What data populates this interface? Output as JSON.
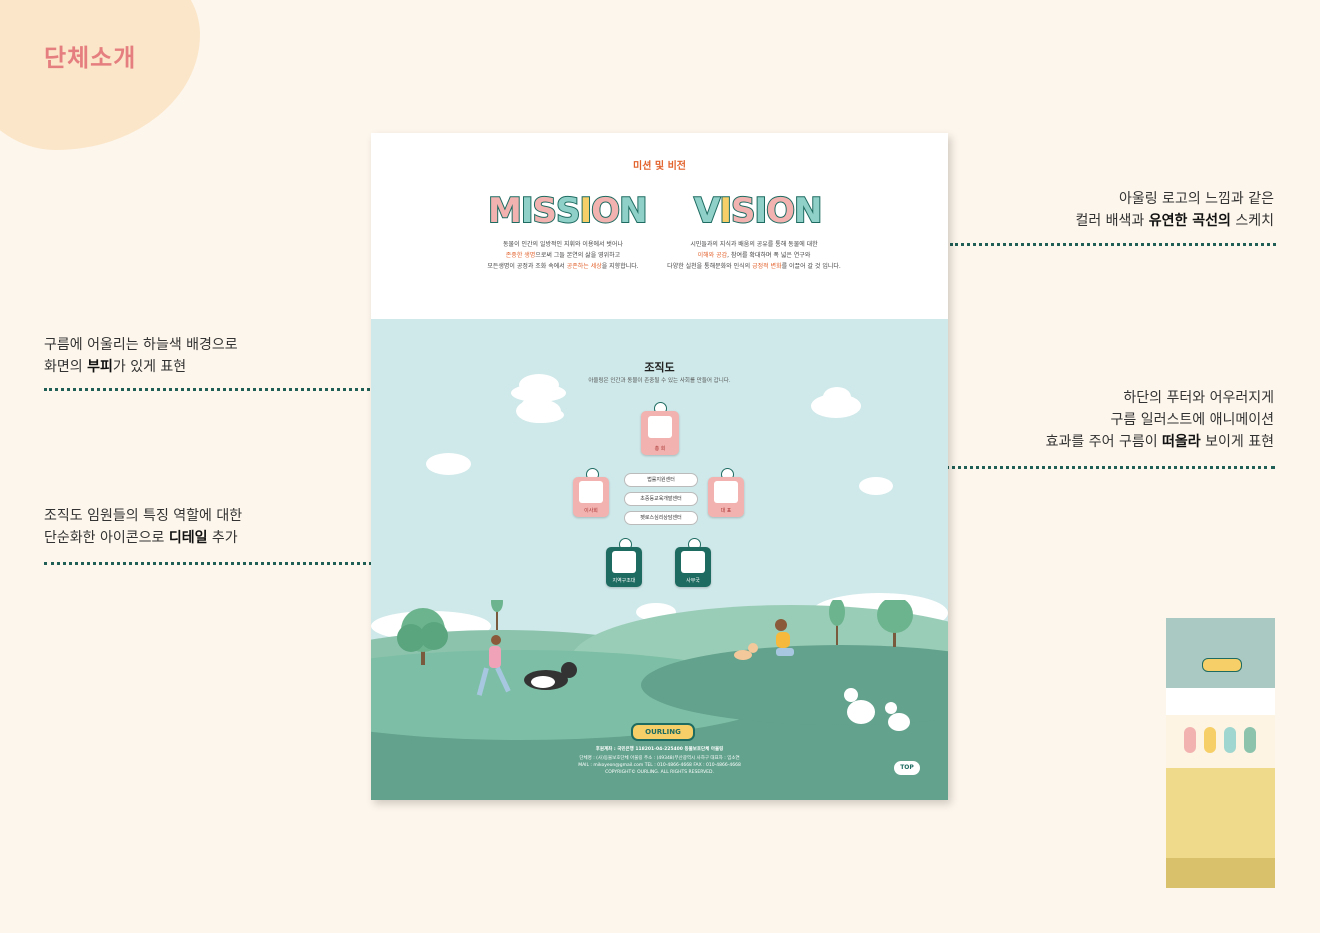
{
  "page": {
    "title": "단체소개"
  },
  "notes": {
    "right_top": {
      "line1": "아울링 로고의 느낌과 같은",
      "line2_pre": "컬러 배색과 ",
      "line2_bold": "유연한 곡선의",
      "line2_post": " 스케치"
    },
    "left_top": {
      "line1": "구름에 어울리는 하늘색 배경으로",
      "line2_pre": "화면의 ",
      "line2_bold": "부피",
      "line2_post": "가 있게 표현"
    },
    "right_mid": {
      "line1": "하단의 푸터와 어우러지게",
      "line2": "구름  일러스트에 애니메이션",
      "line3_pre": "효과를 주어 구름이 ",
      "line3_bold": "떠올라",
      "line3_post": " 보이게 표현"
    },
    "left_bottom": {
      "line1": "조직도 임원들의 특징 역할에 대한",
      "line2_pre": "단순화한 아이콘으로 ",
      "line2_bold": "디테일",
      "line2_post": " 추가"
    }
  },
  "mockup": {
    "section_title": "미션 및 비전",
    "mission": {
      "word": "MISSION",
      "desc1": "동물이 인간의 일방적인 지휘와 이용에서 벗어나",
      "desc2_hl": "존중한 생명",
      "desc2_rest": "으로써 그들 본연의 삶을 영위하고",
      "desc3_pre": "모든생명이 공정과 조화 속에서 ",
      "desc3_hl": "공존하는 세상",
      "desc3_post": "을 지향합니다."
    },
    "vision": {
      "word": "VISION",
      "desc1": "시민들과의 지식과 배움의 공유를 통해 동물에 대한",
      "desc2_hl": "이해와 공감",
      "desc2_rest": ", 참여를 확대하며 폭 넓은 연구와",
      "desc3_pre": "다양한 실천을 통해문화와 인식의 ",
      "desc3_hl": "긍정적 변화",
      "desc3_post": "를 이끌어 갈 것 입니다."
    },
    "org": {
      "title": "조직도",
      "subtitle": "아울링은 인간과 동물이 존중될 수 있는 사회를 만들어 갑니다.",
      "general": "총 회",
      "board": "이사회",
      "ceo": "대 표",
      "center1": "법률지원센터",
      "center2": "초중등교육개발센터",
      "center3": "펫로스심리상담센터",
      "regional": "지역구조대",
      "office": "사무국"
    },
    "footer": {
      "logo": "OURLING",
      "line1": "후원계좌 : 국민은행 118201-04-225400 동물보호단체 아울링",
      "line2": "단체명 : (사)동물보호단체 아울링     주소 : (49348)부산광역시 사하구     대표자 : 임소연",
      "line3": "MAIL : mikoyeon@gmail.com     TEL : 010-4866-4668     FAX : 010-4866-4668",
      "line4": "COPYRIGHT© OURLING. ALL RIGHTS RESERVED.",
      "top_button": "TOP"
    }
  },
  "colors": {
    "accent_pink": "#e57f7f",
    "teal_dark": "#1e6b61",
    "sky": "#cfe8e9",
    "highlight_orange": "#e2622c",
    "background": "#fdf6ec"
  }
}
